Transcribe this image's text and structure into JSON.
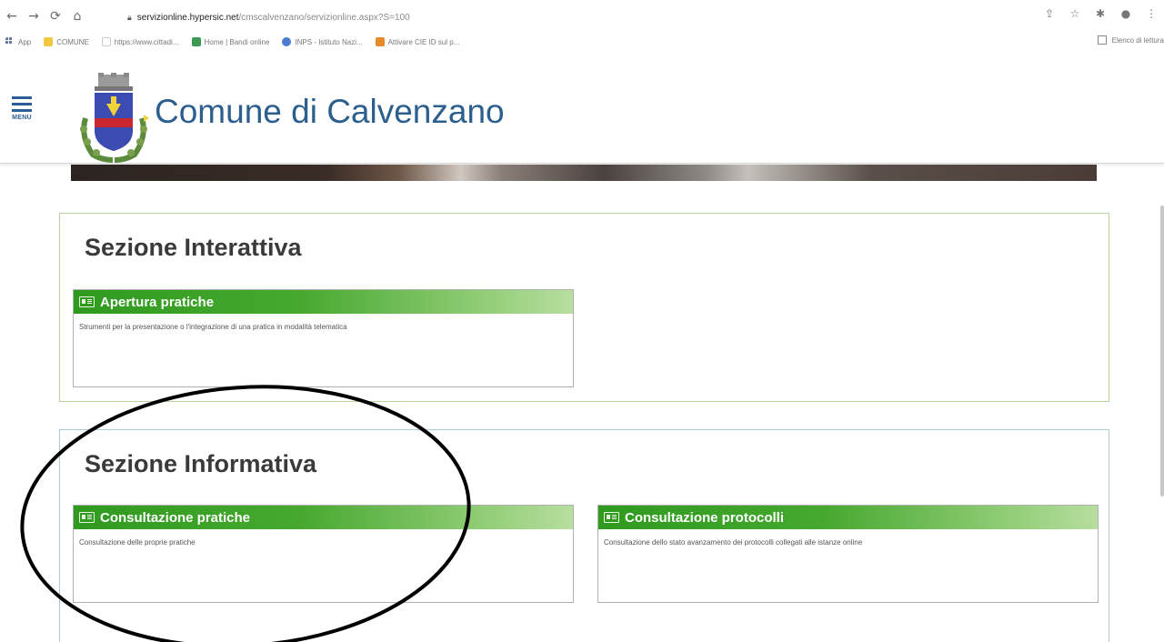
{
  "browser": {
    "url_host": "servizionline.hypersic.net",
    "url_path": "/cmscalvenzano/servizionline.aspx?S=100",
    "bookmarks": [
      {
        "label": "App",
        "color": "#6a7ba2"
      },
      {
        "label": "COMUNE",
        "color": "#f2c744"
      },
      {
        "label": "https://www.cittadi...",
        "color": "#ffffff"
      },
      {
        "label": "Home | Bandi online",
        "color": "#3a9a52"
      },
      {
        "label": "INPS - Istituto Nazi...",
        "color": "#4a7bd0"
      },
      {
        "label": "Attivare CIE ID sul p...",
        "color": "#e58b2a"
      }
    ],
    "reading_list": "Elenco di lettura"
  },
  "site": {
    "menu_label": "MENU",
    "title": "Comune di Calvenzano"
  },
  "sections": {
    "interattiva": {
      "title": "Sezione Interattiva",
      "cards": [
        {
          "title": "Apertura pratiche",
          "description": "Strumenti per la presentazione o l'integrazione di una pratica in modalità telematica"
        }
      ]
    },
    "informativa": {
      "title": "Sezione Informativa",
      "cards": [
        {
          "title": "Consultazione pratiche",
          "description": "Consultazione delle proprie pratiche"
        },
        {
          "title": "Consultazione protocolli",
          "description": "Consultazione dello stato avanzamento dei protocolli collegati alle istanze online"
        }
      ]
    }
  },
  "colors": {
    "brand_blue": "#2c5f8d",
    "card_green": "#2f9a1f"
  }
}
